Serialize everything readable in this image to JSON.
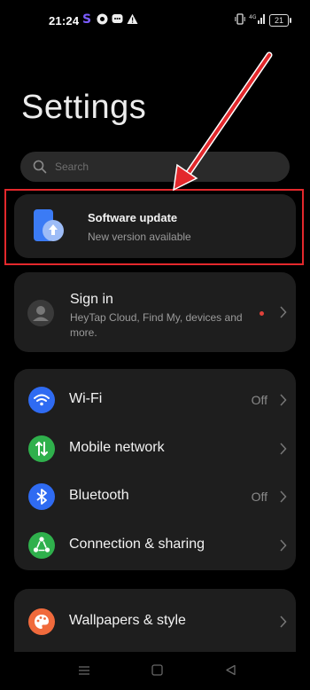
{
  "status_bar": {
    "time": "21:24",
    "battery": "21",
    "icons": [
      "s-app-icon",
      "settings-notif-icon",
      "chat-notif-icon",
      "warning-icon",
      "vibrate-icon",
      "signal-icon",
      "battery-icon"
    ]
  },
  "page_title": "Settings",
  "search": {
    "placeholder": "Search"
  },
  "software_update": {
    "title": "Software update",
    "subtitle": "New version available"
  },
  "sign_in": {
    "title": "Sign in",
    "subtitle": "HeyTap Cloud, Find My, devices and more."
  },
  "network_items": [
    {
      "label": "Wi-Fi",
      "value": "Off",
      "icon": "wifi-icon",
      "color": "#2f6bf2"
    },
    {
      "label": "Mobile network",
      "value": "",
      "icon": "mobile-network-icon",
      "color": "#2fb04c"
    },
    {
      "label": "Bluetooth",
      "value": "Off",
      "icon": "bluetooth-icon",
      "color": "#2f6bf2"
    },
    {
      "label": "Connection & sharing",
      "value": "",
      "icon": "connection-sharing-icon",
      "color": "#2fb04c"
    }
  ],
  "personal_items": [
    {
      "label": "Wallpapers & style",
      "icon": "palette-icon",
      "color": "#f06a3c"
    }
  ],
  "colors": {
    "accent_red": "#e3282c",
    "card": "#1e1e1e",
    "background": "#000000"
  }
}
